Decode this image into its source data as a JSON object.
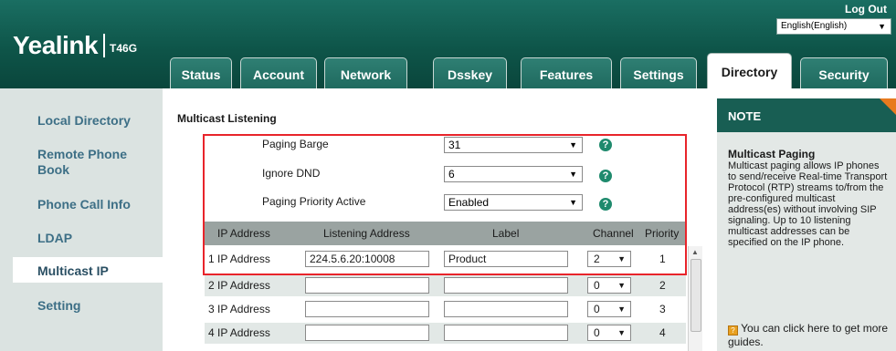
{
  "header": {
    "brand": "Yealink",
    "model": "T46G",
    "logout": "Log Out",
    "language": "English(English)"
  },
  "tabs": [
    {
      "label": "Status"
    },
    {
      "label": "Account"
    },
    {
      "label": "Network"
    },
    {
      "label": "Dsskey"
    },
    {
      "label": "Features"
    },
    {
      "label": "Settings"
    },
    {
      "label": "Directory",
      "active": true
    },
    {
      "label": "Security"
    }
  ],
  "sidebar": {
    "items": [
      {
        "label": "Local Directory"
      },
      {
        "label": "Remote Phone Book"
      },
      {
        "label": "Phone Call Info"
      },
      {
        "label": "LDAP"
      },
      {
        "label": "Multicast IP",
        "active": true
      },
      {
        "label": "Setting"
      }
    ]
  },
  "main": {
    "section_title": "Multicast Listening",
    "paging_barge": {
      "label": "Paging Barge",
      "value": "31"
    },
    "ignore_dnd": {
      "label": "Ignore DND",
      "value": "6"
    },
    "paging_priority_active": {
      "label": "Paging Priority Active",
      "value": "Enabled"
    },
    "table": {
      "headers": [
        "IP Address",
        "Listening Address",
        "Label",
        "Channel",
        "Priority"
      ],
      "rows": [
        {
          "name": "1 IP Address",
          "listening_address": "224.5.6.20:10008",
          "label": "Product",
          "channel": "2",
          "priority": "1"
        },
        {
          "name": "2 IP Address",
          "listening_address": "",
          "label": "",
          "channel": "0",
          "priority": "2"
        },
        {
          "name": "3 IP Address",
          "listening_address": "",
          "label": "",
          "channel": "0",
          "priority": "3"
        },
        {
          "name": "4 IP Address",
          "listening_address": "",
          "label": "",
          "channel": "0",
          "priority": "4"
        }
      ]
    }
  },
  "note": {
    "title": "NOTE",
    "subtitle": "Multicast Paging",
    "body": "Multicast paging allows IP phones to send/receive Real-time Transport Protocol (RTP) streams to/from the pre-configured multicast address(es) without involving SIP signaling. Up to 10 listening multicast addresses can be specified on the IP phone.",
    "guide": "You can click here to get more guides."
  },
  "colors": {
    "header_green": "#0e5549",
    "accent_orange": "#e87a1e",
    "highlight_red": "#e8242b",
    "sidebar_text": "#3d6f86"
  }
}
